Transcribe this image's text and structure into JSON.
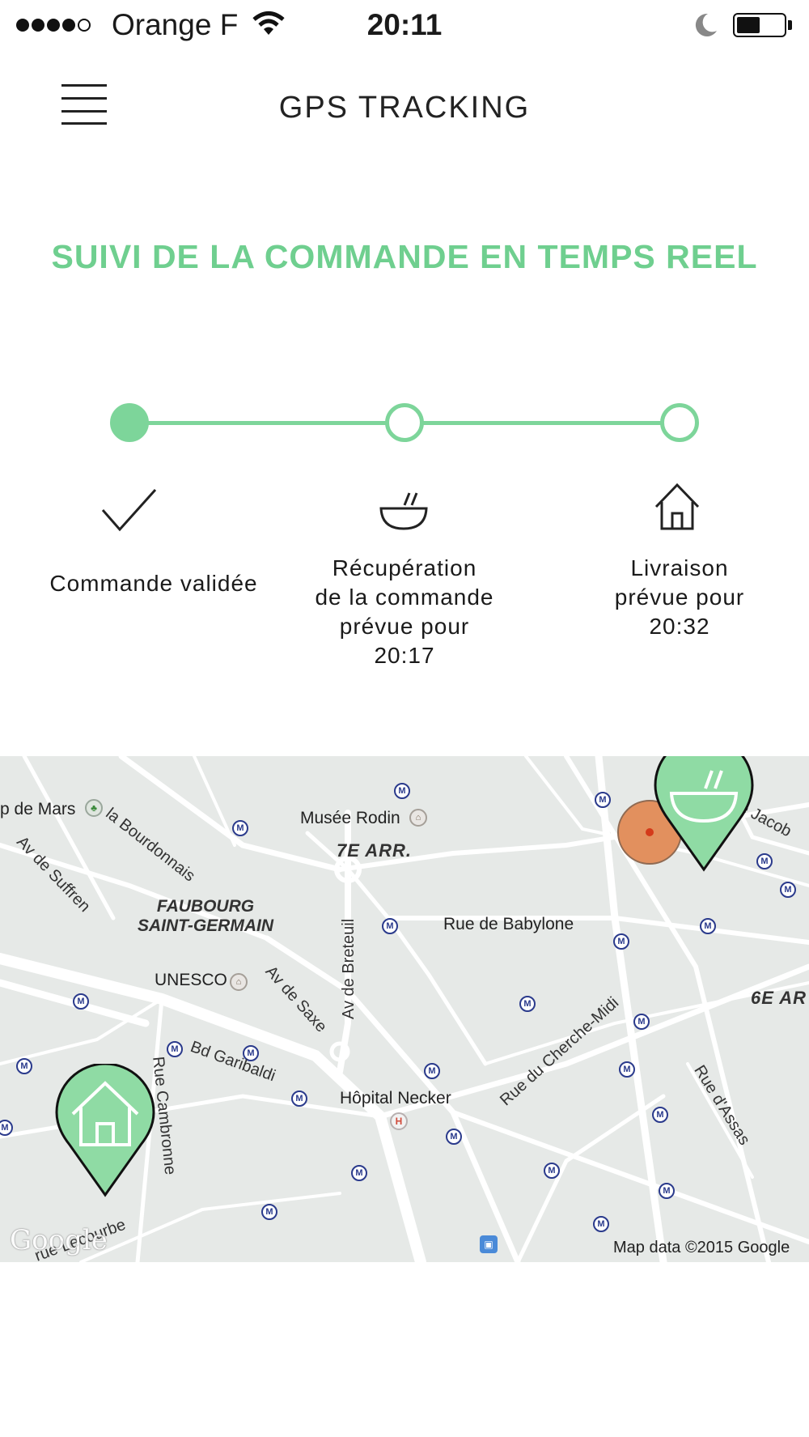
{
  "status_bar": {
    "carrier": "Orange F",
    "time": "20:11",
    "battery_level": 0.5,
    "signal_bars_filled": 4,
    "signal_bars_total": 5
  },
  "header": {
    "title": "GPS TRACKING",
    "menu_icon": "hamburger-menu-icon"
  },
  "heading": "SUIVI DE LA COMMANDE EN TEMPS REEL",
  "accent_color": "#6fcf8f",
  "steps": [
    {
      "label": "Commande validée",
      "icon": "checkmark-icon",
      "status": "done"
    },
    {
      "label_lines": [
        "Récupération",
        "de la commande",
        "prévue pour",
        "20:17"
      ],
      "icon": "bowl-icon",
      "status": "pending"
    },
    {
      "label_lines": [
        "Livraison",
        "prévue pour",
        "20:32"
      ],
      "icon": "house-icon",
      "status": "pending"
    }
  ],
  "map": {
    "labels": {
      "champ_de_mars": "p de Mars",
      "bourdonnais": "la Bourdonnais",
      "suffren": "Av de Suffren",
      "musee_rodin": "Musée Rodin",
      "arr7": "7E ARR.",
      "jacob": "e Jacob",
      "faubourg": "FAUBOURG\nSAINT-GERMAIN",
      "breteuil": "Av de Breteuil",
      "babylone": "Rue de Babylone",
      "unesco": "UNESCO",
      "saxe": "Av de Saxe",
      "cherche_midi": "Rue du Cherche-Midi",
      "arr6": "6E AR",
      "garibaldi": "Bd Garibaldi",
      "cambronne": "Rue Cambronne",
      "necker": "Hôpital Necker",
      "assas": "Rue d'Assas",
      "lecourbe": "rue Lecourbe",
      "attribution": "Map data ©2015 Google",
      "google": "Google"
    },
    "markers": {
      "restaurant": "bowl-marker-icon",
      "courier": "courier-position-dot",
      "home": "home-marker-icon"
    },
    "colors": {
      "marker_fill": "#8fdba4",
      "courier": "#e2905e",
      "metro": "#2a3a8c",
      "roads": "#ffffff",
      "land": "#e6e9e7"
    }
  }
}
